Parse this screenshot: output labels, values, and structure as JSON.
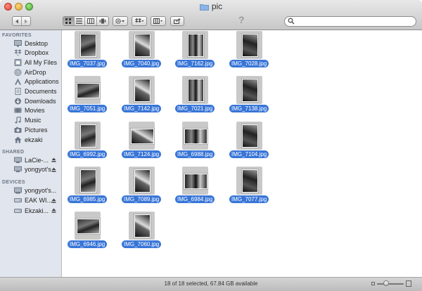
{
  "window": {
    "title": "pic"
  },
  "toolbar": {
    "search_placeholder": "",
    "help_glyph": "?",
    "icons": [
      "back-icon",
      "forward-icon",
      "icon-view-icon",
      "list-view-icon",
      "column-view-icon",
      "cover-flow-icon",
      "gear-icon",
      "dropbox-icon",
      "arrange-icon",
      "share-icon",
      "search-icon"
    ]
  },
  "sidebar": {
    "favorites_header": "FAVORITES",
    "favorites": [
      {
        "label": "Desktop",
        "icon": "desktop-icon"
      },
      {
        "label": "Dropbox",
        "icon": "dropbox-icon"
      },
      {
        "label": "All My Files",
        "icon": "all-files-icon"
      },
      {
        "label": "AirDrop",
        "icon": "airdrop-icon"
      },
      {
        "label": "Applications",
        "icon": "applications-icon"
      },
      {
        "label": "Documents",
        "icon": "documents-icon"
      },
      {
        "label": "Downloads",
        "icon": "downloads-icon"
      },
      {
        "label": "Movies",
        "icon": "movies-icon"
      },
      {
        "label": "Music",
        "icon": "music-icon"
      },
      {
        "label": "Pictures",
        "icon": "pictures-icon"
      },
      {
        "label": "ekzaki",
        "icon": "home-icon"
      }
    ],
    "shared_header": "SHARED",
    "shared": [
      {
        "label": "LaCie-...",
        "icon": "network-computer-icon"
      },
      {
        "label": "yongyot's...",
        "icon": "network-computer-icon"
      }
    ],
    "devices_header": "DEVICES",
    "devices": [
      {
        "label": "yongyot's...",
        "icon": "computer-icon"
      },
      {
        "label": "EAK WI...",
        "icon": "drive-icon"
      },
      {
        "label": "Ekzaki...",
        "icon": "drive-icon"
      }
    ]
  },
  "files": [
    {
      "name": "IMG_7037.jpg",
      "orientation": "portrait"
    },
    {
      "name": "IMG_7040.jpg",
      "orientation": "portrait"
    },
    {
      "name": "IMG_7162.jpg",
      "orientation": "portrait"
    },
    {
      "name": "IMG_7028.jpg",
      "orientation": "portrait"
    },
    {
      "name": "IMG_7051.jpg",
      "orientation": "landscape"
    },
    {
      "name": "IMG_7142.jpg",
      "orientation": "portrait"
    },
    {
      "name": "IMG_7021.jpg",
      "orientation": "portrait"
    },
    {
      "name": "IMG_7138.jpg",
      "orientation": "portrait"
    },
    {
      "name": "IMG_6992.jpg",
      "orientation": "portrait"
    },
    {
      "name": "IMG_7124.jpg",
      "orientation": "landscape"
    },
    {
      "name": "IMG_6988.jpg",
      "orientation": "landscape"
    },
    {
      "name": "IMG_7104.jpg",
      "orientation": "portrait"
    },
    {
      "name": "IMG_6985.jpg",
      "orientation": "portrait"
    },
    {
      "name": "IMG_7089.jpg",
      "orientation": "portrait"
    },
    {
      "name": "IMG_6984.jpg",
      "orientation": "landscape"
    },
    {
      "name": "IMG_7077.jpg",
      "orientation": "portrait"
    },
    {
      "name": "IMG_6946.jpg",
      "orientation": "landscape"
    },
    {
      "name": "IMG_7060.jpg",
      "orientation": "portrait"
    }
  ],
  "status": {
    "text": "18 of 18 selected, 67.84 GB available"
  },
  "colors": {
    "selection": "#3875d7",
    "sidebar_bg": "#e1e6ee",
    "toolbar_top": "#e8e8e8",
    "toolbar_bottom": "#c7c7c7"
  }
}
